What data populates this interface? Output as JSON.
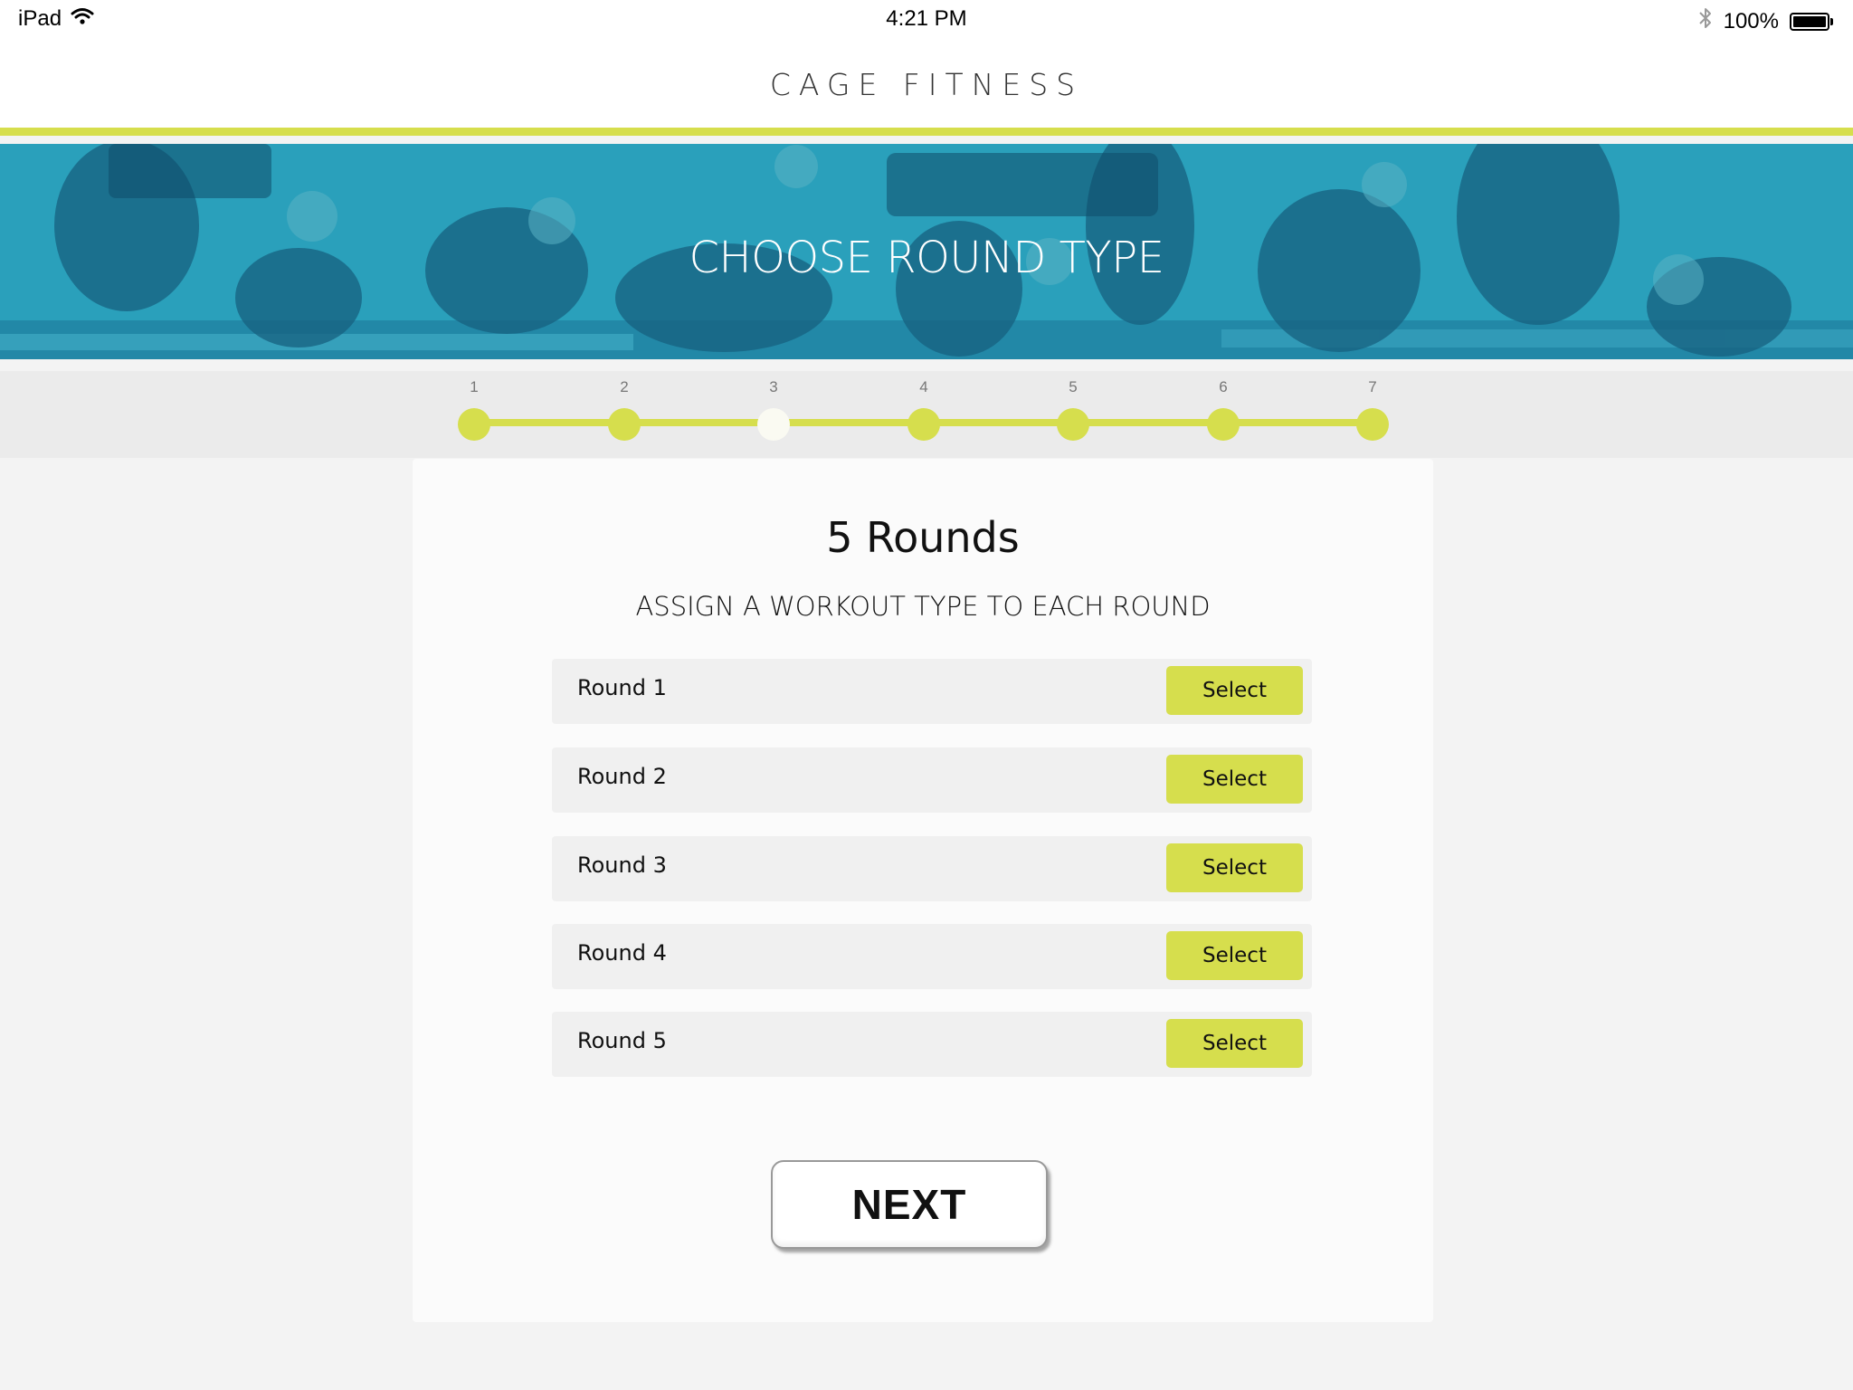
{
  "status_bar": {
    "device": "iPad",
    "time": "4:21 PM",
    "battery": "100%",
    "icons": [
      "wifi-icon",
      "bluetooth-icon",
      "battery-icon"
    ]
  },
  "header": {
    "app_title": "CAGE FITNESS"
  },
  "hero": {
    "title": "CHOOSE ROUND TYPE"
  },
  "stepper": {
    "steps": [
      "1",
      "2",
      "3",
      "4",
      "5",
      "6",
      "7"
    ],
    "current_step": 3
  },
  "card": {
    "heading": "5 Rounds",
    "subheading": "ASSIGN A WORKOUT TYPE TO EACH ROUND",
    "rounds": [
      {
        "label": "Round 1",
        "button": "Select"
      },
      {
        "label": "Round 2",
        "button": "Select"
      },
      {
        "label": "Round 3",
        "button": "Select"
      },
      {
        "label": "Round 4",
        "button": "Select"
      },
      {
        "label": "Round 5",
        "button": "Select"
      }
    ],
    "next_label": "NEXT"
  },
  "colors": {
    "accent": "#d6de4d",
    "hero_teal": "#1d8aaa",
    "card_bg": "#fbfbfb",
    "page_bg": "#f3f3f3"
  }
}
